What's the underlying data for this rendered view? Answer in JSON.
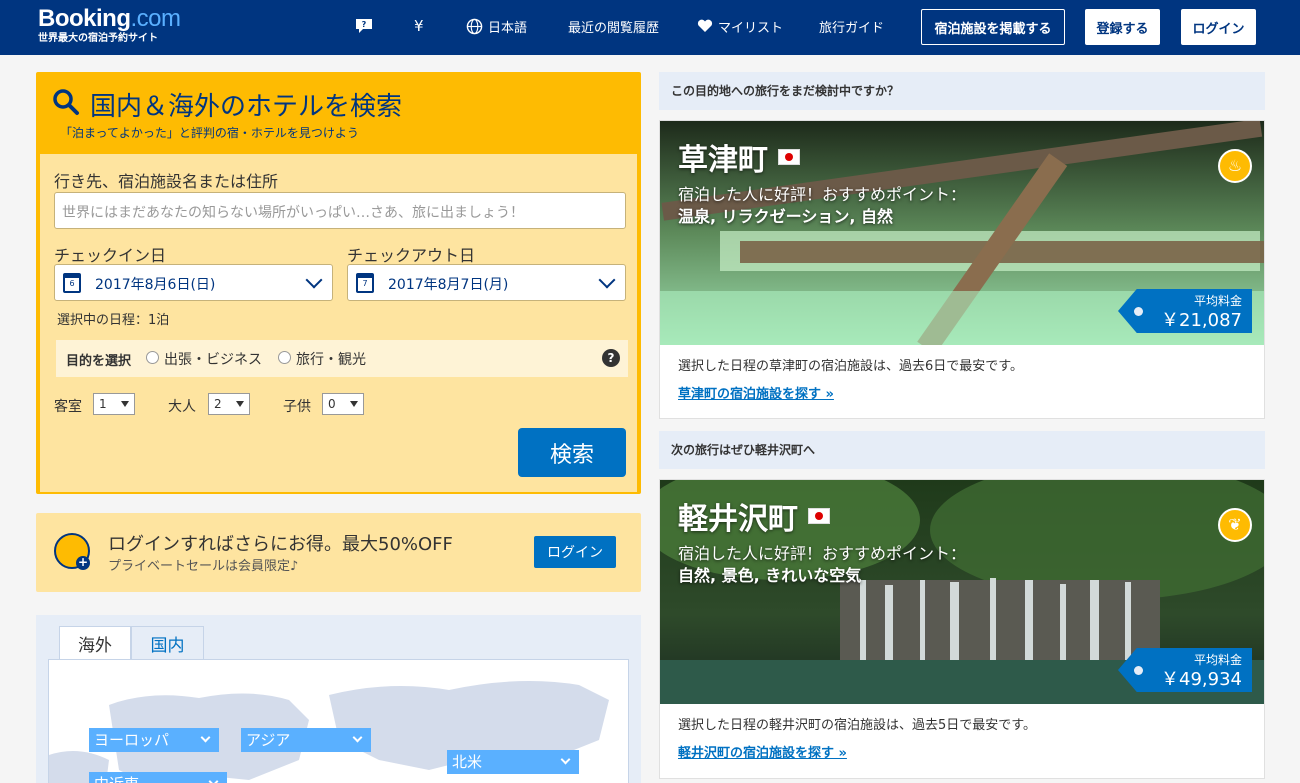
{
  "header": {
    "logo_main": "Booking",
    "logo_dot": ".com",
    "logo_sub": "世界最大の宿泊予約サイト",
    "currency": "¥",
    "language": "日本語",
    "recent": "最近の閲覧履歴",
    "mylist": "マイリスト",
    "guide": "旅行ガイド",
    "list_property": "宿泊施設を掲載する",
    "register": "登録する",
    "login": "ログイン"
  },
  "search": {
    "title": "国内＆海外のホテルを検索",
    "subtitle": "「泊まってよかった」と評判の宿・ホテルを見つけよう",
    "destination_label": "行き先、宿泊施設名または住所",
    "destination_placeholder": "世界にはまだあなたの知らない場所がいっぱい…さあ、旅に出ましょう！",
    "checkin_label": "チェックイン日",
    "checkin_value": "2017年8月6日(日)",
    "checkin_day": "6",
    "checkout_label": "チェックアウト日",
    "checkout_value": "2017年8月7日(月)",
    "checkout_day": "7",
    "nights": "選択中の日程：1泊",
    "purpose_label": "目的を選択",
    "purpose_business": "出張・ビジネス",
    "purpose_leisure": "旅行・観光",
    "help": "?",
    "rooms_label": "客室",
    "rooms_value": "1",
    "adults_label": "大人",
    "adults_value": "2",
    "children_label": "子供",
    "children_value": "0",
    "search_button": "検索"
  },
  "promo": {
    "title": "ログインすればさらにお得。最大50%OFF",
    "subtitle": "プライベートセールは会員限定♪",
    "button": "ログイン"
  },
  "map": {
    "tabs": [
      "海外",
      "国内"
    ],
    "regions": [
      "ヨーロッパ",
      "アジア",
      "北米",
      "中近東"
    ]
  },
  "right": {
    "header1": "この目的地への旅行をまだ検討中ですか？",
    "header2": "次の旅行はぜひ軽井沢町へ",
    "cards": [
      {
        "city": "草津町",
        "line1": "宿泊した人に好評！おすすめポイント：",
        "line2": "温泉, リラクゼーション, 自然",
        "badge": "♨",
        "price_label": "平均料金",
        "price": "￥21,087",
        "desc": "選択した日程の草津町の宿泊施設は、過去6日で最安です。",
        "link": "草津町の宿泊施設を探す »"
      },
      {
        "city": "軽井沢町",
        "line1": "宿泊した人に好評！おすすめポイント：",
        "line2": "自然, 景色, きれいな空気",
        "badge": "❦",
        "price_label": "平均料金",
        "price": "￥49,934",
        "desc": "選択した日程の軽井沢町の宿泊施設は、過去5日で最安です。",
        "link": "軽井沢町の宿泊施設を探す »"
      }
    ]
  },
  "colors": {
    "brand": "#003580",
    "accent": "#febb02",
    "link": "#0071c2"
  }
}
